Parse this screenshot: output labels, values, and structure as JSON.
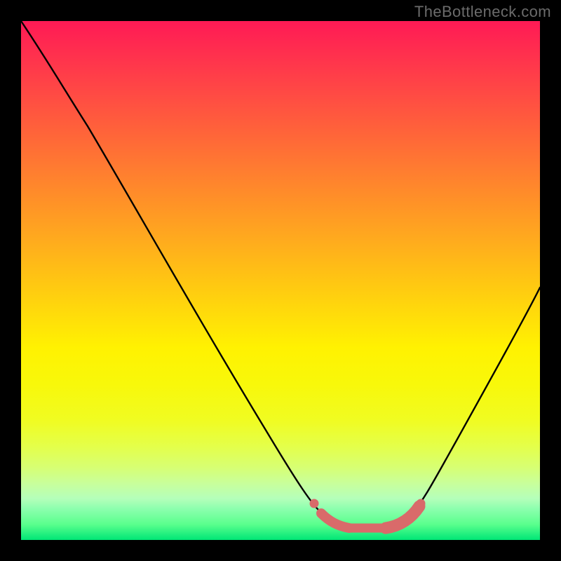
{
  "watermark": "TheBottleneck.com",
  "chart_data": {
    "type": "line",
    "title": "",
    "xlabel": "",
    "ylabel": "",
    "xlim": [
      0,
      100
    ],
    "ylim": [
      0,
      100
    ],
    "grid": false,
    "legend": false,
    "series": [
      {
        "name": "bottleneck-curve",
        "x": [
          0,
          5,
          10,
          15,
          20,
          25,
          30,
          35,
          40,
          45,
          50,
          55,
          58,
          62,
          66,
          70,
          74,
          78,
          82,
          86,
          90,
          94,
          98,
          100
        ],
        "y": [
          100,
          92,
          83,
          75,
          67,
          59,
          51,
          43,
          35,
          27,
          19,
          11,
          6,
          3,
          2,
          2,
          3,
          5,
          11,
          20,
          31,
          42,
          52,
          57
        ],
        "color": "#000000"
      }
    ],
    "annotations": [
      {
        "name": "optimal-range-highlight",
        "x_start": 56,
        "x_end": 78,
        "color": "#e57373",
        "note": "flat valley marked with pink dots/strokes"
      }
    ],
    "background": {
      "type": "vertical-gradient",
      "stops": [
        {
          "pos": 0,
          "color": "#ff1a55"
        },
        {
          "pos": 50,
          "color": "#ffd200"
        },
        {
          "pos": 90,
          "color": "#e4ff4a"
        },
        {
          "pos": 100,
          "color": "#00e676"
        }
      ]
    }
  }
}
